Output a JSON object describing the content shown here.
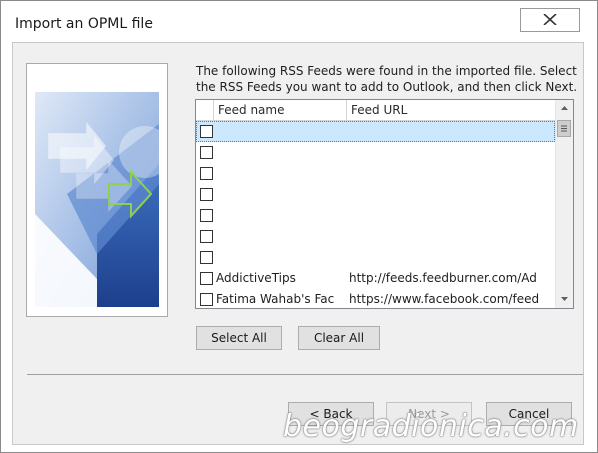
{
  "window": {
    "title": "Import an OPML file",
    "close_glyph": "✕"
  },
  "instructions": "The following RSS Feeds were found in the imported file. Select the RSS Feeds you want to add to Outlook, and then click Next.",
  "list": {
    "headers": {
      "name": "Feed name",
      "url": "Feed URL"
    },
    "rows": [
      {
        "name": "",
        "url": "",
        "obscured": true,
        "selected": true,
        "checked": false
      },
      {
        "name": "",
        "url": "",
        "obscured": true,
        "checked": false
      },
      {
        "name": "",
        "url": "",
        "obscured": true,
        "checked": false
      },
      {
        "name": "",
        "url": "",
        "obscured": true,
        "checked": false
      },
      {
        "name": "",
        "url": "",
        "obscured": true,
        "checked": false
      },
      {
        "name": "",
        "url": "",
        "obscured": true,
        "checked": false
      },
      {
        "name": "",
        "url": "",
        "obscured": true,
        "checked": false
      },
      {
        "name": "AddictiveTips",
        "url": "http://feeds.feedburner.com/Ad",
        "obscured": false,
        "checked": false
      },
      {
        "name": "Fatima Wahab's Fac",
        "url": "https://www.facebook.com/feed",
        "obscured": false,
        "checked": false
      }
    ]
  },
  "buttons": {
    "select_all": "Select All",
    "clear_all": "Clear All",
    "back": "< Back",
    "next": "Next >",
    "cancel": "Cancel"
  },
  "watermark": "beogradionica.com",
  "colors": {
    "selection": "#cce8ff",
    "art_blue": "#2f5fb3",
    "art_green": "#8fd14f"
  }
}
